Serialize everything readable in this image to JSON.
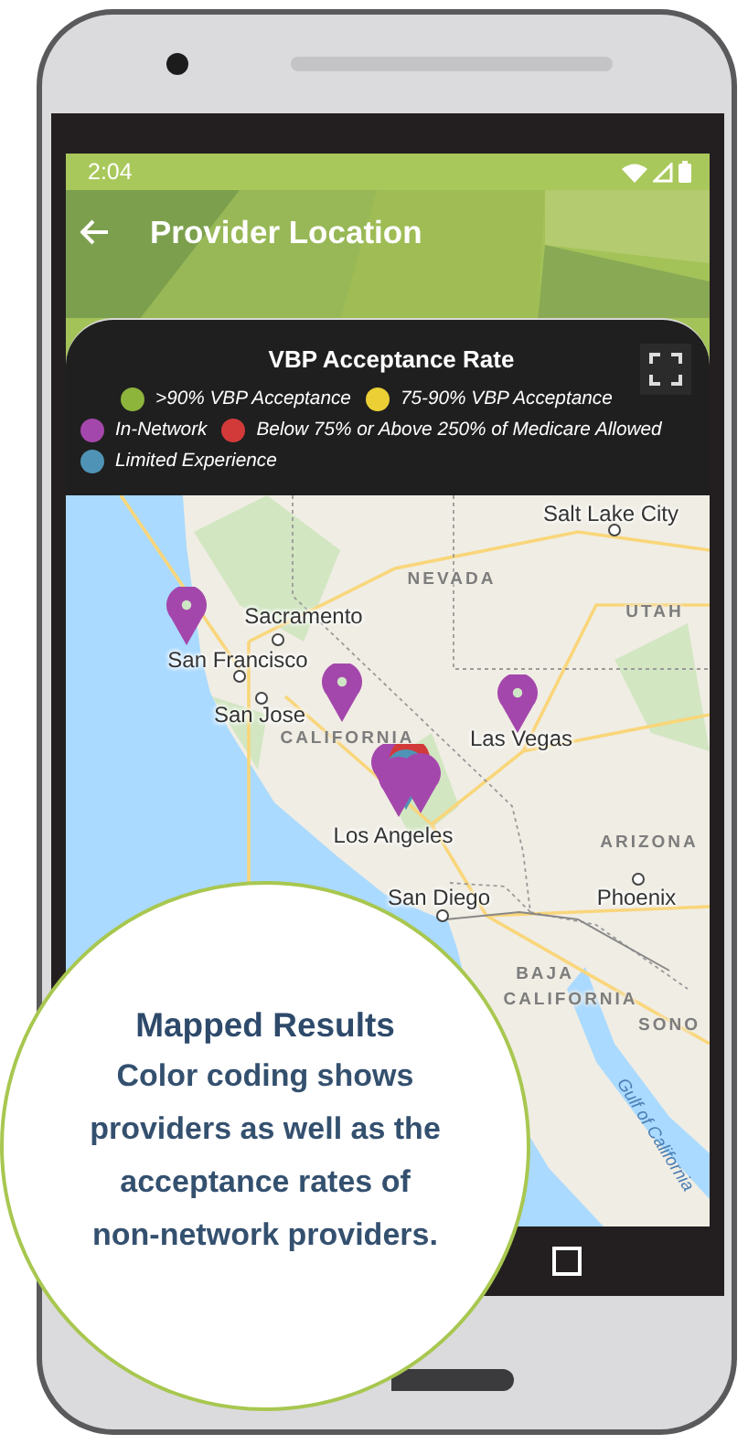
{
  "status_bar": {
    "time": "2:04"
  },
  "header": {
    "title": "Provider Location"
  },
  "legend": {
    "title": "VBP Acceptance Rate",
    "items": [
      {
        "label": ">90% VBP Acceptance",
        "color": "#8db53c"
      },
      {
        "label": "75-90% VBP Acceptance",
        "color": "#ebcf35"
      },
      {
        "label": "In-Network",
        "color": "#a447ac"
      },
      {
        "label": "Below 75% or Above 250% of Medicare Allowed",
        "color": "#d23a3a"
      },
      {
        "label": "Limited Experience",
        "color": "#4f94b6"
      }
    ]
  },
  "map": {
    "labels": [
      {
        "text": "Salt Lake City",
        "kind": "city"
      },
      {
        "text": "NEVADA",
        "kind": "region"
      },
      {
        "text": "UTAH",
        "kind": "region"
      },
      {
        "text": "Sacramento",
        "kind": "city"
      },
      {
        "text": "San Francisco",
        "kind": "city"
      },
      {
        "text": "San Jose",
        "kind": "city"
      },
      {
        "text": "CALIFORNIA",
        "kind": "region"
      },
      {
        "text": "Las Vegas",
        "kind": "city"
      },
      {
        "text": "Los Angeles",
        "kind": "city"
      },
      {
        "text": "ARIZONA",
        "kind": "region"
      },
      {
        "text": "San Diego",
        "kind": "city"
      },
      {
        "text": "Phoenix",
        "kind": "city"
      },
      {
        "text": "BAJA",
        "kind": "region"
      },
      {
        "text": "CALIFORNIA",
        "kind": "region"
      },
      {
        "text": "SONO",
        "kind": "region"
      },
      {
        "text": "Gulf of California",
        "kind": "water"
      }
    ],
    "pins": [
      {
        "color": "#a447ac"
      },
      {
        "color": "#a447ac"
      },
      {
        "color": "#a447ac"
      }
    ],
    "cluster": {
      "pins": [
        {
          "color": "#a447ac"
        },
        {
          "color": "#d23a3a"
        },
        {
          "color": "#4f94b6"
        },
        {
          "color": "#a447ac"
        },
        {
          "color": "#a447ac"
        }
      ]
    }
  },
  "callout": {
    "title": "Mapped Results",
    "text": "Color coding shows providers as well as the acceptance rates of non-network providers."
  }
}
